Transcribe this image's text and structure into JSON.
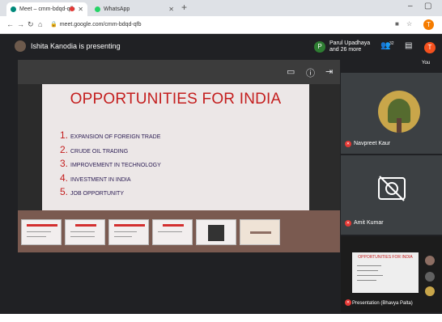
{
  "browser": {
    "tabs": [
      {
        "label": "Meet – cmm-bdqd-qfb",
        "fav_color": "#00897b"
      },
      {
        "label": "WhatsApp",
        "fav_color": "#25d366"
      }
    ],
    "url": "meet.google.com/cmm-bdqd-qfb",
    "profile_initial": "T"
  },
  "meet": {
    "presenting_label": "Ishita Kanodia is presenting",
    "participant_chip": {
      "initial": "P",
      "line1": "Parul Upadhaya",
      "line2": "and 26 more"
    },
    "people_count": "32",
    "self_initial": "T",
    "self_label": "You"
  },
  "slide": {
    "title": "OPPORTUNITIES FOR INDIA",
    "items": [
      {
        "num": "1.",
        "text": "EXPANSION OF FOREIGN TRADE"
      },
      {
        "num": "2.",
        "text": "CRUDE OIL TRADING"
      },
      {
        "num": "3.",
        "text": "IMPROVEMENT IN TECHNOLOGY"
      },
      {
        "num": "4.",
        "text": "INVESTMENT IN INDIA"
      },
      {
        "num": "5.",
        "text": "JOB OPPORTUNITY"
      }
    ]
  },
  "tiles": [
    {
      "name": "Navpreet Kaur"
    },
    {
      "name": "Amit Kumar"
    }
  ],
  "mini_share": {
    "title": "OPPORTUNITIES FOR INDIA",
    "label": "Presentation (Bhavya Palta)"
  }
}
